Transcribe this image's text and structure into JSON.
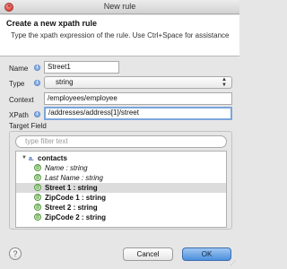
{
  "window": {
    "title": "New rule"
  },
  "header": {
    "title": "Create a new xpath rule",
    "description": "Type the xpath expression of the rule. Use Ctrl+Space for assistance"
  },
  "form": {
    "name": {
      "label": "Name",
      "value": "Street1"
    },
    "type": {
      "label": "Type",
      "value": "string"
    },
    "context": {
      "label": "Context",
      "value": "/employees/employee"
    },
    "xpath": {
      "label": "XPath",
      "value": "/addresses/address[1]/street"
    }
  },
  "target": {
    "label": "Target Field",
    "filter_placeholder": "type filter text",
    "root": {
      "label": "contacts",
      "icon": "element-icon",
      "expanded": true
    },
    "items": [
      {
        "label": "Name : string",
        "style": "italic",
        "selected": false
      },
      {
        "label": "Last Name : string",
        "style": "italic",
        "selected": false
      },
      {
        "label": "Street 1 : string",
        "style": "bold",
        "selected": true
      },
      {
        "label": "ZipCode 1 : string",
        "style": "bold",
        "selected": false
      },
      {
        "label": "Street 2 : string",
        "style": "bold",
        "selected": false
      },
      {
        "label": "ZipCode 2 : string",
        "style": "bold",
        "selected": false
      }
    ]
  },
  "buttons": {
    "help": "?",
    "cancel": "Cancel",
    "ok": "OK"
  },
  "icons": {
    "info": "info-icon",
    "attribute": "attribute-icon",
    "element": "element-icon"
  },
  "colors": {
    "accent": "#4c8fdc",
    "focus_border": "#7ca6dc",
    "attribute_green": "#4f9a3c"
  }
}
